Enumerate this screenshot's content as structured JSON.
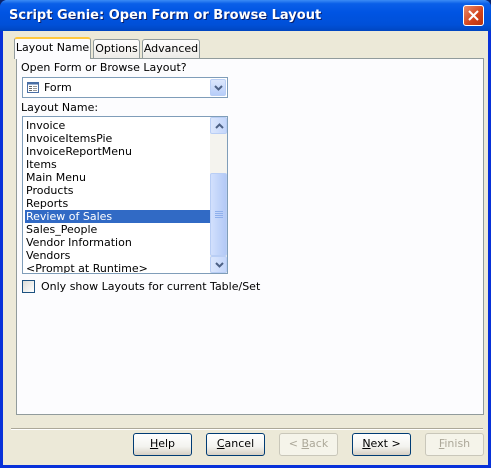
{
  "window": {
    "title": "Script Genie:  Open Form or Browse Layout"
  },
  "tabs": [
    {
      "label": "Layout Name",
      "active": true
    },
    {
      "label": "Options",
      "active": false
    },
    {
      "label": "Advanced",
      "active": false
    }
  ],
  "open_form": {
    "label": "Open Form or Browse Layout?",
    "selected": "Form",
    "icon": "form-layout-icon"
  },
  "layout_list": {
    "label": "Layout Name:",
    "items": [
      "Invoice",
      "InvoiceItemsPie",
      "InvoiceReportMenu",
      "Items",
      "Main Menu",
      "Products",
      "Reports",
      "Review of Sales",
      "Sales_People",
      "Vendor Information",
      "Vendors",
      "<Prompt at Runtime>"
    ],
    "selected_index": 7
  },
  "filter_checkbox": {
    "label": "Only show Layouts for current Table/Set",
    "checked": false
  },
  "buttons": {
    "help": {
      "label": "Help",
      "accel": "H",
      "rest": "elp"
    },
    "cancel": {
      "label": "Cancel",
      "accel": "C",
      "rest": "ancel"
    },
    "back": {
      "label": "< Back",
      "pre": "< ",
      "accel": "B",
      "rest": "ack"
    },
    "next": {
      "label": "Next >",
      "accel": "N",
      "rest": "ext >"
    },
    "finish": {
      "label": "Finish",
      "accel": "F",
      "rest": "inish"
    }
  },
  "colors": {
    "titlebar": "#0054e3",
    "selection": "#316ac5",
    "dialog_bg": "#ece9d8",
    "active_tab_accent": "#ffc83c"
  }
}
